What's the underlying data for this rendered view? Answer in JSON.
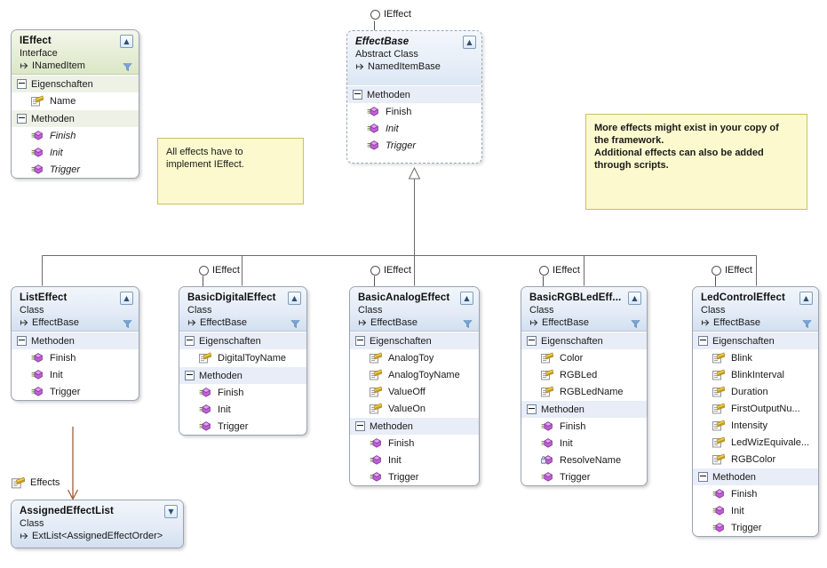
{
  "diagram": {
    "kind": "uml-class-diagram",
    "language_of_labels": "German compartment headers",
    "compartment_labels": {
      "properties": "Eigenschaften",
      "methods": "Methoden"
    }
  },
  "shapes": {
    "ieffect": {
      "title": "IEffect",
      "stereotype": "Interface",
      "base": "INamedItem",
      "properties_label": "Eigenschaften",
      "methods_label": "Methoden",
      "properties": [
        {
          "name": "Name",
          "icon": "property-icon",
          "italic": false
        }
      ],
      "methods": [
        {
          "name": "Finish",
          "icon": "method-icon",
          "italic": true
        },
        {
          "name": "Init",
          "icon": "method-icon",
          "italic": true
        },
        {
          "name": "Trigger",
          "icon": "method-icon",
          "italic": true
        }
      ]
    },
    "effectbase": {
      "title": "EffectBase",
      "stereotype": "Abstract Class",
      "base": "NamedItemBase",
      "methods_label": "Methoden",
      "methods": [
        {
          "name": "Finish",
          "icon": "method-icon",
          "italic": false
        },
        {
          "name": "Init",
          "icon": "method-icon",
          "italic": true
        },
        {
          "name": "Trigger",
          "icon": "method-icon",
          "italic": true
        }
      ]
    },
    "listeffect": {
      "title": "ListEffect",
      "stereotype": "Class",
      "base": "EffectBase",
      "methods_label": "Methoden",
      "methods": [
        {
          "name": "Finish",
          "icon": "method-icon",
          "italic": false
        },
        {
          "name": "Init",
          "icon": "method-icon",
          "italic": false
        },
        {
          "name": "Trigger",
          "icon": "method-icon",
          "italic": false
        }
      ]
    },
    "basicdigitaleffect": {
      "title": "BasicDigitalEffect",
      "stereotype": "Class",
      "base": "EffectBase",
      "properties_label": "Eigenschaften",
      "methods_label": "Methoden",
      "properties": [
        {
          "name": "DigitalToyName",
          "icon": "property-icon"
        }
      ],
      "methods": [
        {
          "name": "Finish",
          "icon": "method-icon"
        },
        {
          "name": "Init",
          "icon": "method-icon"
        },
        {
          "name": "Trigger",
          "icon": "method-icon"
        }
      ]
    },
    "basicanalogeffect": {
      "title": "BasicAnalogEffect",
      "stereotype": "Class",
      "base": "EffectBase",
      "properties_label": "Eigenschaften",
      "methods_label": "Methoden",
      "properties": [
        {
          "name": "AnalogToy",
          "icon": "property-icon"
        },
        {
          "name": "AnalogToyName",
          "icon": "property-icon"
        },
        {
          "name": "ValueOff",
          "icon": "property-icon"
        },
        {
          "name": "ValueOn",
          "icon": "property-icon"
        }
      ],
      "methods": [
        {
          "name": "Finish",
          "icon": "method-icon"
        },
        {
          "name": "Init",
          "icon": "method-icon"
        },
        {
          "name": "Trigger",
          "icon": "method-icon"
        }
      ]
    },
    "basicrgbledeffect": {
      "title": "BasicRGBLedEff...",
      "stereotype": "Class",
      "base": "EffectBase",
      "properties_label": "Eigenschaften",
      "methods_label": "Methoden",
      "properties": [
        {
          "name": "Color",
          "icon": "property-icon"
        },
        {
          "name": "RGBLed",
          "icon": "property-icon"
        },
        {
          "name": "RGBLedName",
          "icon": "property-icon"
        }
      ],
      "methods": [
        {
          "name": "Finish",
          "icon": "method-icon"
        },
        {
          "name": "Init",
          "icon": "method-icon"
        },
        {
          "name": "ResolveName",
          "icon": "method-private-icon"
        },
        {
          "name": "Trigger",
          "icon": "method-icon"
        }
      ]
    },
    "ledcontroleffect": {
      "title": "LedControlEffect",
      "stereotype": "Class",
      "base": "EffectBase",
      "properties_label": "Eigenschaften",
      "methods_label": "Methoden",
      "properties": [
        {
          "name": "Blink",
          "icon": "property-icon"
        },
        {
          "name": "BlinkInterval",
          "icon": "property-icon"
        },
        {
          "name": "Duration",
          "icon": "property-icon"
        },
        {
          "name": "FirstOutputNu...",
          "icon": "property-icon"
        },
        {
          "name": "Intensity",
          "icon": "property-icon"
        },
        {
          "name": "LedWizEquivale...",
          "icon": "property-icon"
        },
        {
          "name": "RGBColor",
          "icon": "property-icon"
        }
      ],
      "methods": [
        {
          "name": "Finish",
          "icon": "method-icon"
        },
        {
          "name": "Init",
          "icon": "method-icon"
        },
        {
          "name": "Trigger",
          "icon": "method-icon"
        }
      ]
    },
    "assignedeffectlist": {
      "title": "AssignedEffectList",
      "stereotype": "Class",
      "base": "ExtList<AssignedEffectOrder>",
      "collapsed": true
    }
  },
  "lollipops": {
    "effectbase": "IEffect",
    "basicdigitaleffect": "IEffect",
    "basicanalogeffect": "IEffect",
    "basicrgbledeffect": "IEffect",
    "ledcontroleffect": "IEffect"
  },
  "association": {
    "role_label": "Effects",
    "role_icon": "property-icon"
  },
  "notes": [
    {
      "id": "note-implement-ieffect",
      "lines": [
        "All effects have to",
        "implement IEffect."
      ]
    },
    {
      "id": "note-more-effects",
      "lines": [
        "More effects might exist in your copy of",
        "the framework.",
        "Additional effects can also be added",
        "through scripts."
      ]
    }
  ],
  "colors": {
    "note_background": "#fbf9cd",
    "note_border": "#c8bf6a",
    "class_header": "#dde8f6",
    "interface_header": "#e6eed6",
    "compartment_header": "#e8edf7",
    "association_line": "#9c5f3c",
    "inheritance_line": "#6b6b6b",
    "property_icon": "#f0c419",
    "method_icon": "#b04fc8"
  }
}
